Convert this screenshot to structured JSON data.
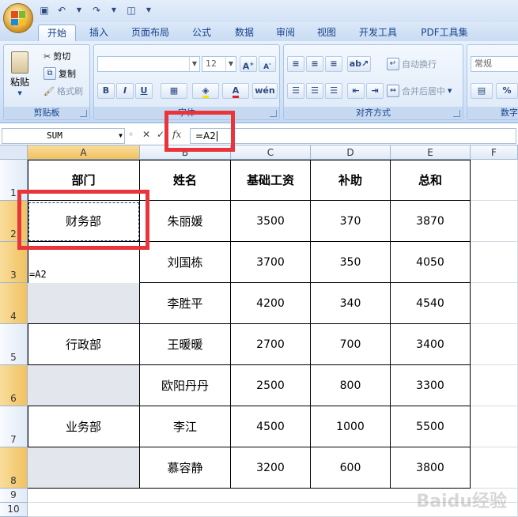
{
  "tabs": [
    "开始",
    "插入",
    "页面布局",
    "公式",
    "数据",
    "审阅",
    "视图",
    "开发工具",
    "PDF工具集"
  ],
  "ribbon": {
    "clipboard": {
      "paste": "粘贴",
      "cut": "剪切",
      "copy": "复制",
      "format_painter": "格式刷",
      "label": "剪贴板"
    },
    "font": {
      "size": "12",
      "label": "字体"
    },
    "alignment": {
      "wrap": "自动换行",
      "merge": "合并后居中",
      "label": "对齐方式"
    },
    "number": {
      "format": "常规",
      "label": "数字"
    }
  },
  "formula_bar": {
    "name_box": "SUM",
    "formula": "=A2"
  },
  "columns": [
    "A",
    "B",
    "C",
    "D",
    "E",
    "F"
  ],
  "rows": [
    "1",
    "2",
    "3",
    "4",
    "5",
    "6",
    "7",
    "8",
    "9",
    "10"
  ],
  "table": {
    "headers": [
      "部门",
      "姓名",
      "基础工资",
      "补助",
      "总和"
    ],
    "depts": [
      "财务部",
      "行政部",
      "业务部"
    ],
    "editing_text": "=A2",
    "records": [
      [
        "朱丽媛",
        "3500",
        "370",
        "3870"
      ],
      [
        "刘国栋",
        "3700",
        "350",
        "4050"
      ],
      [
        "李胜平",
        "4200",
        "340",
        "4540"
      ],
      [
        "王暖暖",
        "2700",
        "700",
        "3400"
      ],
      [
        "欧阳丹丹",
        "2500",
        "800",
        "3300"
      ],
      [
        "李江",
        "4500",
        "1000",
        "5500"
      ],
      [
        "慕容静",
        "3200",
        "600",
        "3800"
      ]
    ]
  },
  "watermark": "Baidu经验"
}
